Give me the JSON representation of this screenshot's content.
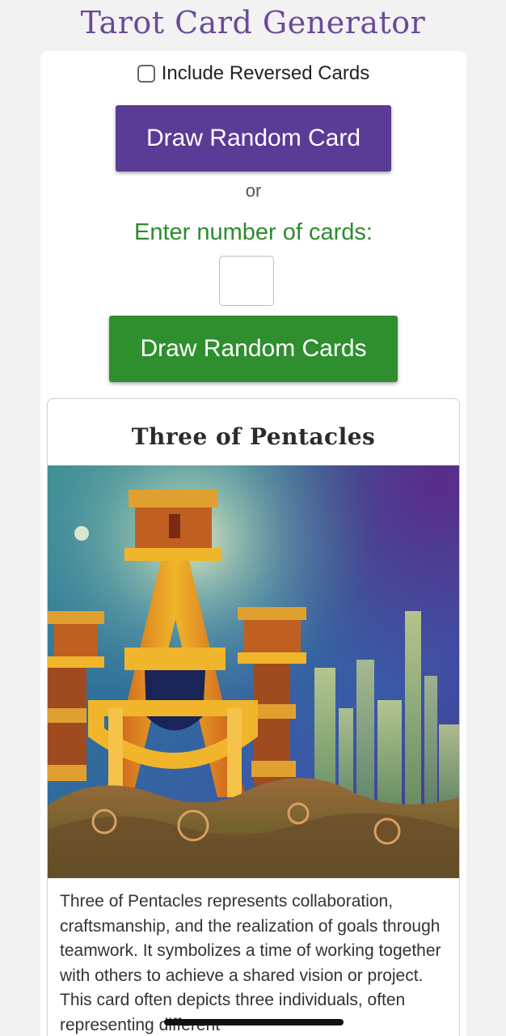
{
  "header": {
    "title": "Tarot Card Generator"
  },
  "controls": {
    "reversed_label": "Include Reversed Cards",
    "reversed_checked": false,
    "draw_one_label": "Draw Random Card",
    "or_text": "or",
    "count_label": "Enter number of cards:",
    "count_value": "",
    "draw_many_label": "Draw Random Cards"
  },
  "card": {
    "name": "Three of Pentacles",
    "description": "Three of Pentacles represents collaboration, craftsmanship, and the realization of goals through teamwork. It symbolizes a time of working together with others to achieve a shared vision or project. This card often depicts three individuals, often representing different"
  },
  "colors": {
    "title": "#6a4a9a",
    "primary_button": "#5a3b96",
    "secondary_button": "#2f8f2f",
    "count_label": "#2e8b2e",
    "background": "#f2f2f2"
  }
}
